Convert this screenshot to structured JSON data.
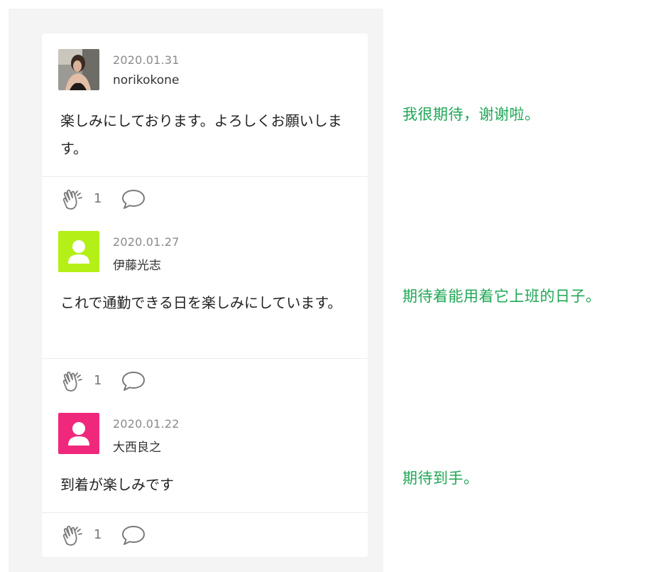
{
  "comments": [
    {
      "date": "2020.01.31",
      "author": "norikokone",
      "avatar_type": "photo",
      "body": "楽しみにしております。よろしくお願いします。",
      "claps": "1"
    },
    {
      "date": "2020.01.27",
      "author": "伊藤光志",
      "avatar_type": "default-user",
      "avatar_color": "#b4ef18",
      "body": "これで通勤できる日を楽しみにしています。",
      "claps": "1"
    },
    {
      "date": "2020.01.22",
      "author": "大西良之",
      "avatar_type": "default-user",
      "avatar_color": "#f0287c",
      "body": "到着が楽しみです",
      "claps": "1"
    }
  ],
  "translations": [
    "我很期待，谢谢啦。",
    "期待着能用着它上班的日子。",
    "期待到手。"
  ],
  "colors": {
    "translation_text": "#1fa756",
    "icon_stroke": "#7a7a7a"
  },
  "icons": {
    "clap": "clap-hands-icon",
    "reply": "speech-bubble-icon",
    "avatar_placeholder": "user-silhouette-icon"
  }
}
